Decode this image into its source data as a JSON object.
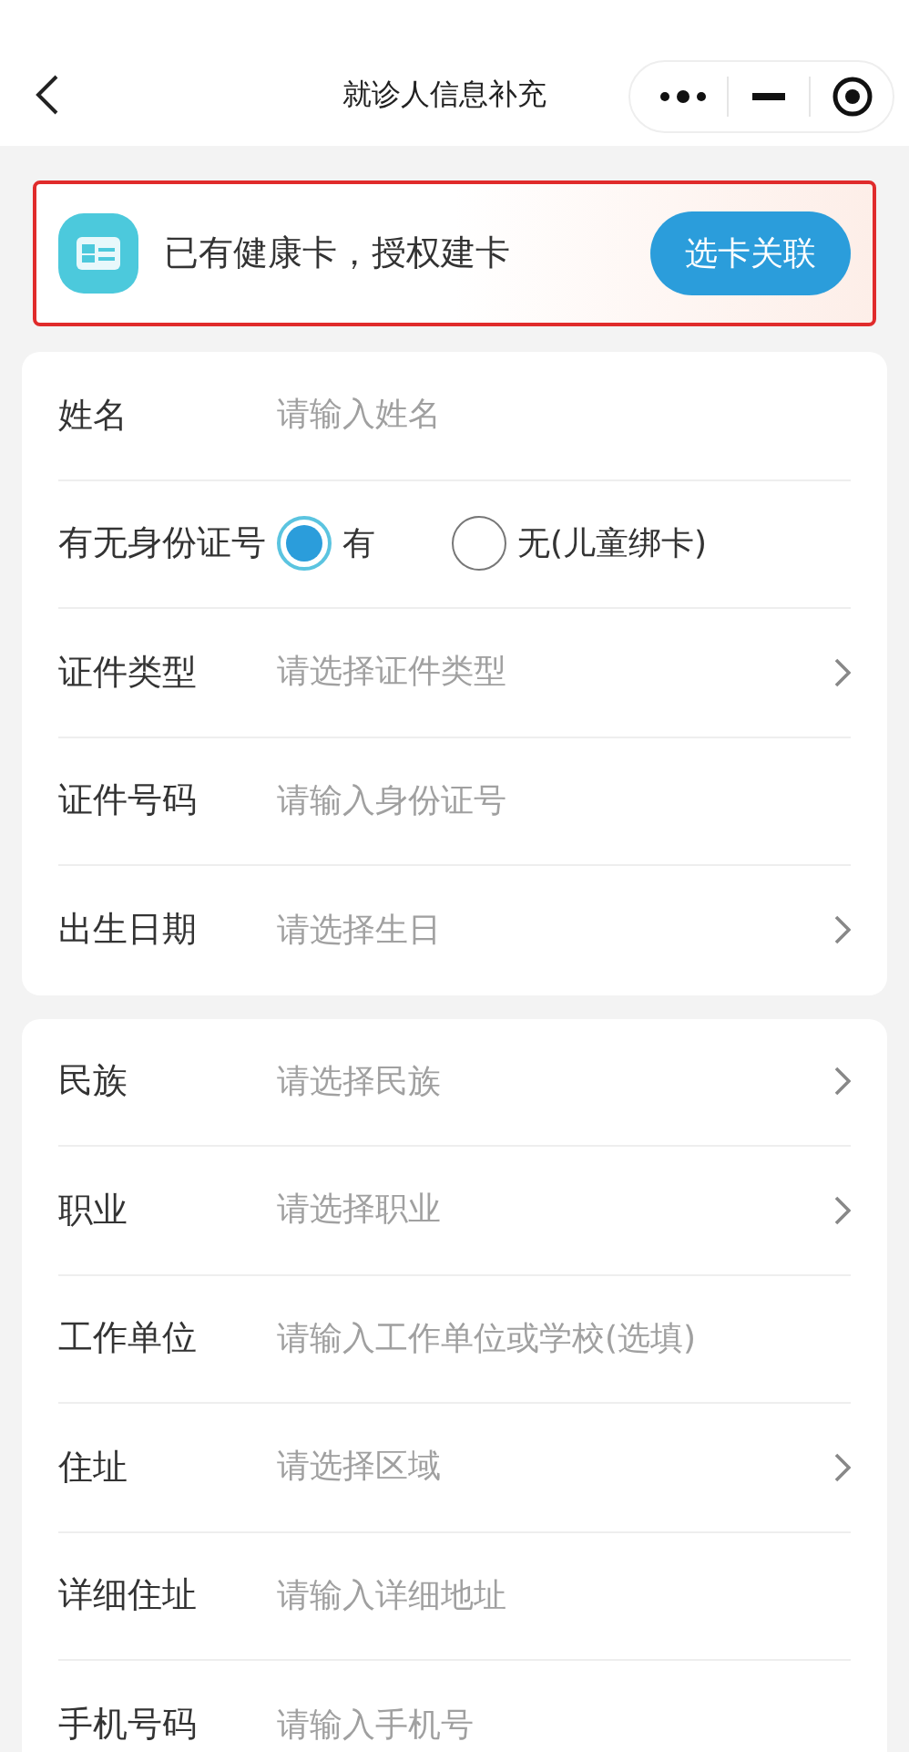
{
  "nav": {
    "title": "就诊人信息补充"
  },
  "banner": {
    "text": "已有健康卡，授权建卡",
    "button": "选卡关联"
  },
  "sections": [
    {
      "fields": [
        {
          "kind": "input",
          "label": "姓名",
          "placeholder": "请输入姓名"
        },
        {
          "kind": "radio",
          "label": "有无身份证号",
          "options": [
            {
              "label": "有",
              "selected": true
            },
            {
              "label": "无(儿童绑卡)",
              "selected": false
            }
          ]
        },
        {
          "kind": "select",
          "label": "证件类型",
          "placeholder": "请选择证件类型"
        },
        {
          "kind": "input",
          "label": "证件号码",
          "placeholder": "请输入身份证号"
        },
        {
          "kind": "select",
          "label": "出生日期",
          "placeholder": "请选择生日"
        }
      ]
    },
    {
      "fields": [
        {
          "kind": "select",
          "label": "民族",
          "placeholder": "请选择民族"
        },
        {
          "kind": "select",
          "label": "职业",
          "placeholder": "请选择职业"
        },
        {
          "kind": "input",
          "label": "工作单位",
          "placeholder": "请输入工作单位或学校(选填)"
        },
        {
          "kind": "select",
          "label": "住址",
          "placeholder": "请选择区域"
        },
        {
          "kind": "input",
          "label": "详细住址",
          "placeholder": "请输入详细地址"
        },
        {
          "kind": "input",
          "label": "手机号码",
          "placeholder": "请输入手机号"
        }
      ]
    }
  ]
}
